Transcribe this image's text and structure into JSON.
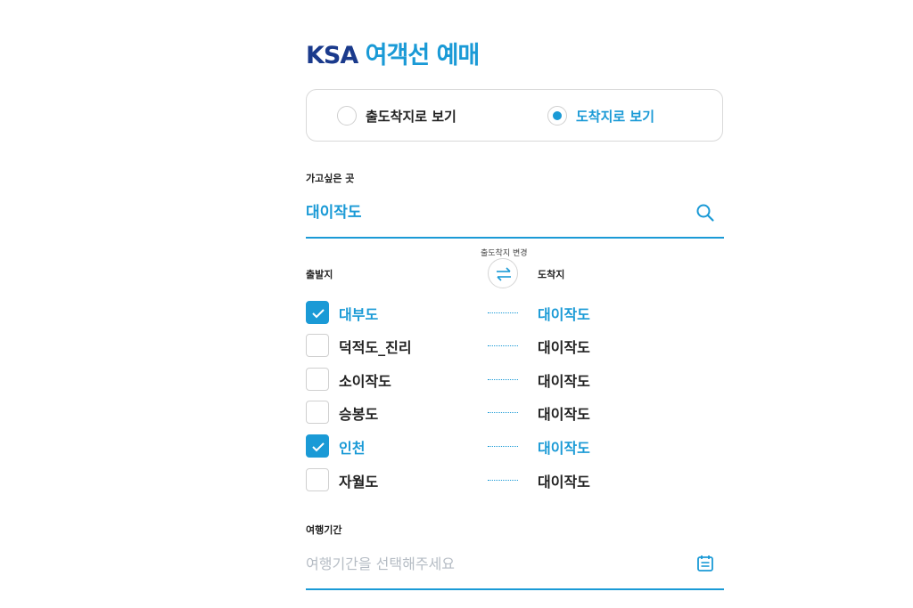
{
  "header": {
    "brand": "KSA",
    "title": "여객선 예매"
  },
  "view_mode": {
    "options": [
      {
        "label": "출도착지로 보기",
        "selected": false
      },
      {
        "label": "도착지로 보기",
        "selected": true
      }
    ]
  },
  "destination": {
    "label": "가고싶은 곳",
    "value": "대이작도",
    "icon": "search-icon"
  },
  "swap": {
    "caption": "출도착지 변경",
    "icon": "swap-arrows-icon"
  },
  "columns": {
    "origin": "출발지",
    "destination": "도착지"
  },
  "routes": [
    {
      "origin": "대부도",
      "destination": "대이작도",
      "checked": true
    },
    {
      "origin": "덕적도_진리",
      "destination": "대이작도",
      "checked": false
    },
    {
      "origin": "소이작도",
      "destination": "대이작도",
      "checked": false
    },
    {
      "origin": "승봉도",
      "destination": "대이작도",
      "checked": false
    },
    {
      "origin": "인천",
      "destination": "대이작도",
      "checked": true
    },
    {
      "origin": "자월도",
      "destination": "대이작도",
      "checked": false
    }
  ],
  "travel_period": {
    "label": "여행기간",
    "placeholder": "여행기간을 선택해주세요",
    "icon": "calendar-icon"
  },
  "colors": {
    "accent": "#1a9ad6",
    "brand": "#1a3a8c",
    "placeholder": "#b5bcc4"
  }
}
